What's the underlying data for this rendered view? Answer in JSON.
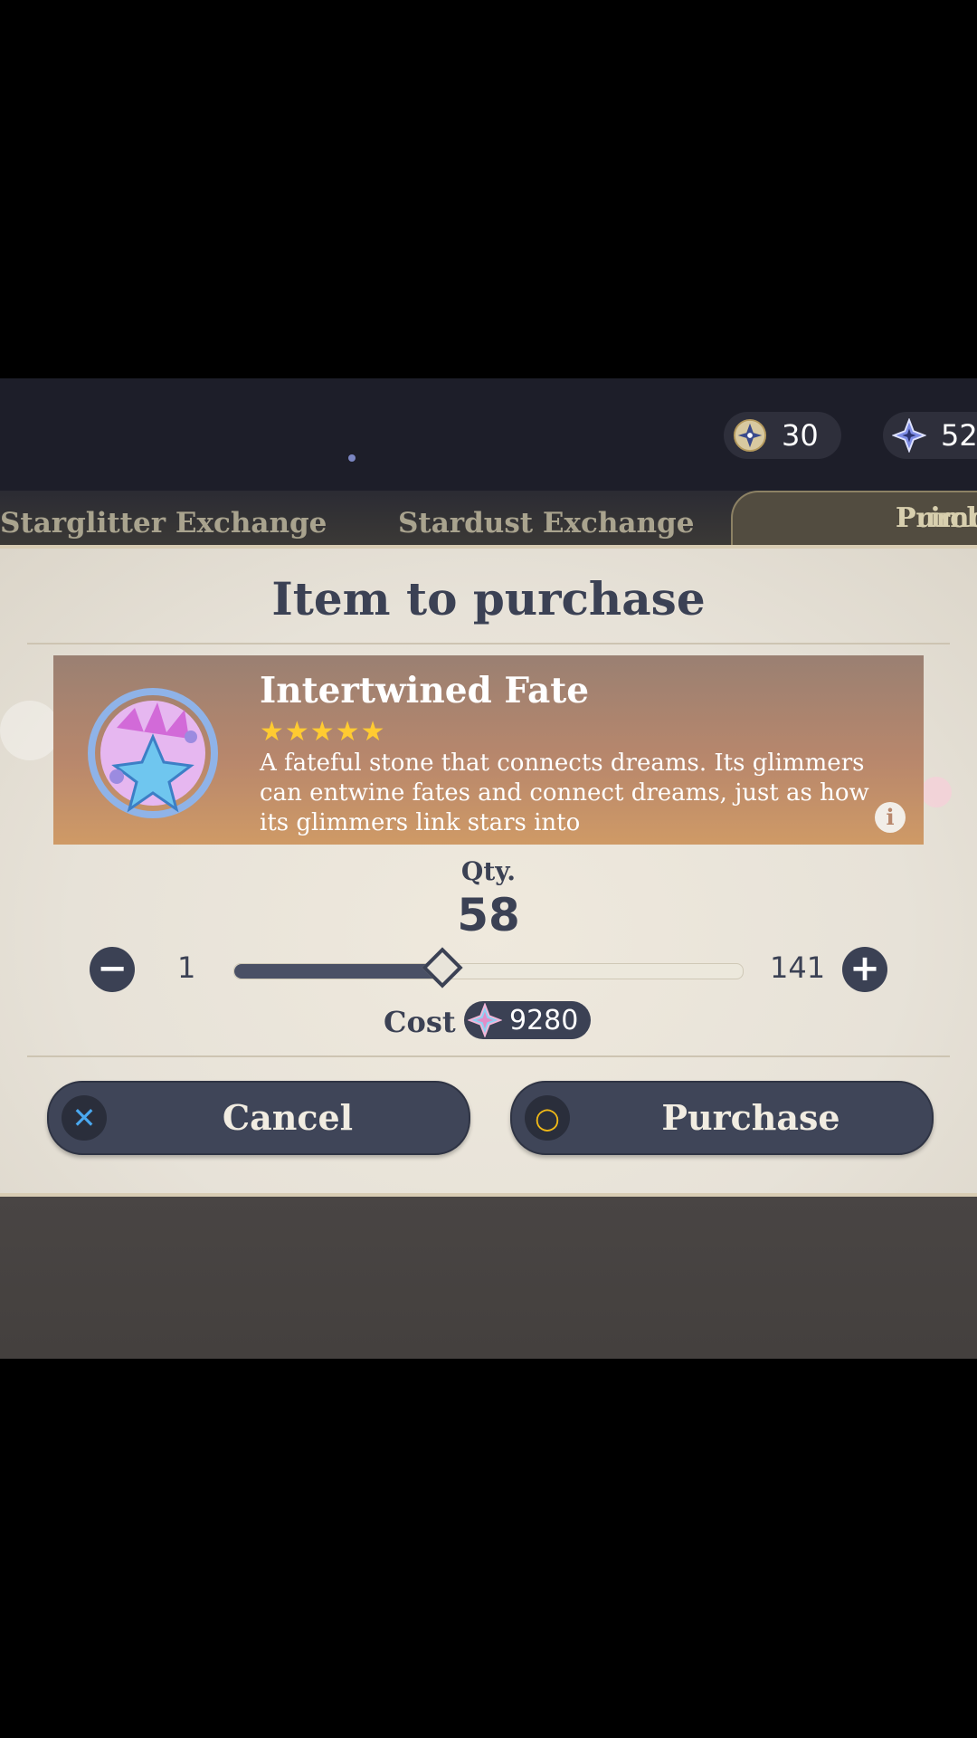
{
  "currencies": [
    {
      "icon": "masterless-starglitter-icon",
      "value": "30"
    },
    {
      "icon": "primogem-icon",
      "value": "52"
    }
  ],
  "tabs": [
    {
      "label": "Starglitter Exchange"
    },
    {
      "label": "Stardust Exchange"
    },
    {
      "label": "Purchase W",
      "label2": "Primogem"
    }
  ],
  "dialog": {
    "title": "Item to purchase",
    "item": {
      "name": "Intertwined Fate",
      "rarity_stars": "★★★★★",
      "rarity": 5,
      "description": "A fateful stone that connects dreams. Its glimmers can entwine fates and connect dreams, just as how its glimmers link stars into",
      "info_icon": "i"
    },
    "quantity": {
      "label": "Qty.",
      "value": "58",
      "min": "1",
      "max": "141",
      "min_button": "−",
      "max_button": "+",
      "slider_fraction": 0.41
    },
    "cost": {
      "label": "Cost",
      "icon": "primogem-icon",
      "value": "9280"
    },
    "buttons": {
      "cancel": {
        "label": "Cancel",
        "glyph": "✕"
      },
      "purchase": {
        "label": "Purchase",
        "glyph": "○"
      }
    }
  },
  "colors": {
    "panel": "#e7e2d8",
    "accent": "#3b4154",
    "star": "#ffcb31",
    "cancel_glyph": "#4aa8ef",
    "purchase_glyph": "#f0b917"
  }
}
